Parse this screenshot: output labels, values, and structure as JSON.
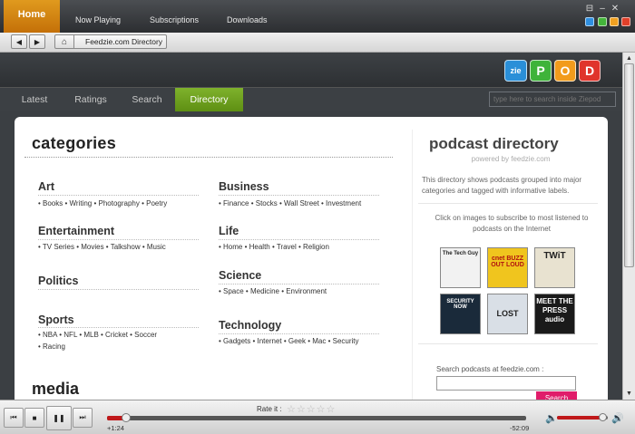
{
  "topnav": {
    "home": "Home",
    "links": [
      "Now Playing",
      "Subscriptions",
      "Downloads"
    ]
  },
  "window_controls": {
    "top": [
      "restore-icon",
      "minimize-icon",
      "close-icon"
    ],
    "colors": [
      "#2f8fe0",
      "#44b53a",
      "#f0a020",
      "#e0402a"
    ]
  },
  "address": {
    "back_icon": "◀",
    "forward_icon": "▶",
    "home_icon": "⌂",
    "crumb": "Feedzie.com Directory"
  },
  "logo": {
    "letters": [
      "zie",
      "P",
      "O",
      "D"
    ],
    "colors": [
      "#2a8fd8",
      "#3eb33a",
      "#f29b1c",
      "#e0342b"
    ]
  },
  "tabs": [
    "Latest",
    "Ratings",
    "Search",
    "Directory"
  ],
  "active_tab": "Directory",
  "search_inside": {
    "placeholder": "type here to search inside Ziepod"
  },
  "categories": {
    "title": "categories",
    "left": [
      {
        "name": "Art",
        "tags": "• Books  • Writing  • Photography  • Poetry"
      },
      {
        "name": "Entertainment",
        "tags": "• TV Series  • Movies  • Talkshow  • Music"
      },
      {
        "name": "Politics",
        "tags": ""
      },
      {
        "name": "Sports",
        "tags": "• NBA  • NFL  • MLB  • Cricket  • Soccer",
        "tags2": "• Racing"
      }
    ],
    "right": [
      {
        "name": "Business",
        "tags": "• Finance  • Stocks  • Wall Street  • Investment"
      },
      {
        "name": "Life",
        "tags": "• Home  • Health  • Travel  • Religion"
      },
      {
        "name": "Science",
        "tags": "• Space  • Medicine  • Environment"
      },
      {
        "name": "Technology",
        "tags": "• Gadgets  • Internet  • Geek  • Mac  • Security"
      }
    ],
    "media_title": "media"
  },
  "directory": {
    "title": "podcast directory",
    "powered": "powered by feedzie.com",
    "description": "This directory shows podcasts grouped into major categories and tagged with informative labels.",
    "click_text": "Click on images to subscribe to most listened to podcasts on the Internet",
    "podcasts": [
      {
        "label": "The Tech Guy",
        "bg": "#f2f2f2",
        "fg": "#222"
      },
      {
        "label": "cnet BUZZ OUT LOUD",
        "bg": "#f0c51e",
        "fg": "#b01010"
      },
      {
        "label": "TWiT",
        "bg": "#e8e2d0",
        "fg": "#222"
      },
      {
        "label": "SECURITY NOW",
        "bg": "#1a2a3a",
        "fg": "#fff"
      },
      {
        "label": "LOST",
        "bg": "#d9dfe6",
        "fg": "#222"
      },
      {
        "label": "MEET THE PRESS audio",
        "bg": "#1a1a1a",
        "fg": "#fff"
      }
    ],
    "search_label": "Search podcasts at feedzie.com :",
    "search_button": "Search"
  },
  "player": {
    "rate_label": "Rate it :",
    "stars": "☆☆☆☆☆",
    "rating": 0,
    "elapsed": "+1:24",
    "remaining": "-52:09",
    "progress": 0.026,
    "volume": 0.9,
    "prev_icon": "⏮",
    "stop_icon": "■",
    "pause_icon": "❚❚",
    "next_icon": "⏭"
  }
}
